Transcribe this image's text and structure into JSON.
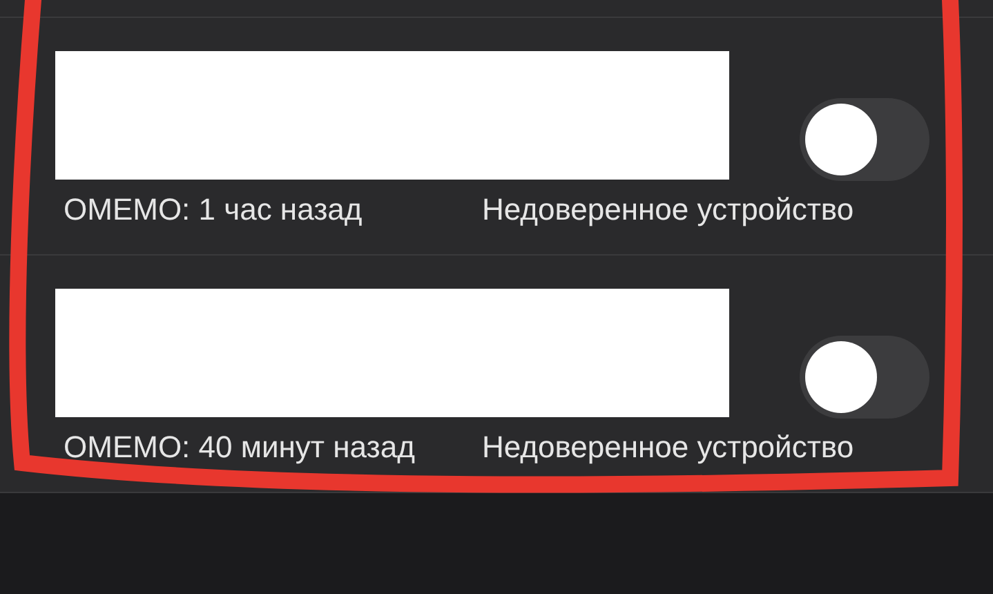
{
  "devices": [
    {
      "last_seen": "OMEMO: 1 час назад",
      "trust": "Недоверенное устройство",
      "enabled": false
    },
    {
      "last_seen": "OMEMO: 40 минут назад",
      "trust": "Недоверенное устройство",
      "enabled": false
    }
  ]
}
